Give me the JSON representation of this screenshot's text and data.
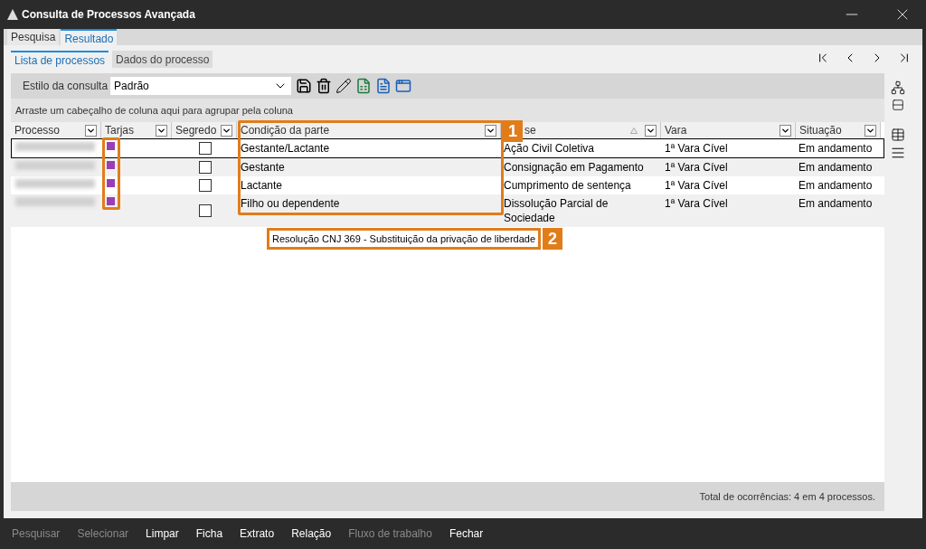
{
  "window": {
    "title": "Consulta de Processos Avançada"
  },
  "tabs": [
    {
      "label": "Pesquisa",
      "selected": false
    },
    {
      "label": "Resultado",
      "selected": true
    }
  ],
  "subtabs": [
    {
      "label": "Lista de processos",
      "selected": true
    },
    {
      "label": "Dados do processo",
      "selected": false
    }
  ],
  "toolbar": {
    "label": "Estilo da consulta",
    "style_value": "Padrão"
  },
  "grid": {
    "group_hint": "Arraste um cabeçalho de coluna aqui para agrupar pela coluna",
    "columns": [
      {
        "label": "Processo"
      },
      {
        "label": "Tarjas"
      },
      {
        "label": "Segredo"
      },
      {
        "label": "Condição da parte"
      },
      {
        "label": "se",
        "sorted": true
      },
      {
        "label": "Vara"
      },
      {
        "label": "Situação"
      }
    ],
    "rows": [
      {
        "selected": true,
        "color": "#9b3db8",
        "segredo": false,
        "condicao": "Gestante/Lactante",
        "classe": "Ação Civil Coletiva",
        "vara": "1ª Vara Cível",
        "situacao": "Em andamento"
      },
      {
        "selected": false,
        "color": "#9b3db8",
        "segredo": false,
        "condicao": "Gestante",
        "classe": "Consignação em Pagamento",
        "vara": "1ª Vara Cível",
        "situacao": "Em andamento"
      },
      {
        "selected": false,
        "color": "#9b3db8",
        "segredo": false,
        "condicao": "Lactante",
        "classe": "Cumprimento de sentença",
        "vara": "1ª Vara Cível",
        "situacao": "Em andamento"
      },
      {
        "selected": false,
        "color": "#9b3db8",
        "segredo": false,
        "condicao": "Filho ou dependente",
        "classe": "Dissolução Parcial de Sociedade",
        "vara": "1ª Vara Cível",
        "situacao": "Em andamento"
      }
    ],
    "tooltip": "Resolução CNJ 369 - Substituição da privação de liberdade",
    "total": "Total de ocorrências: 4 em 4 processos."
  },
  "callouts": [
    "1",
    "2"
  ],
  "bottom_buttons": [
    {
      "label": "Pesquisar",
      "disabled": true
    },
    {
      "label": "Selecionar",
      "disabled": true
    },
    {
      "label": "Limpar",
      "disabled": false
    },
    {
      "label": "Ficha",
      "disabled": false
    },
    {
      "label": "Extrato",
      "disabled": false
    },
    {
      "label": "Relação",
      "disabled": false
    },
    {
      "label": "Fluxo de trabalho",
      "disabled": true
    },
    {
      "label": "Fechar",
      "disabled": false
    }
  ]
}
